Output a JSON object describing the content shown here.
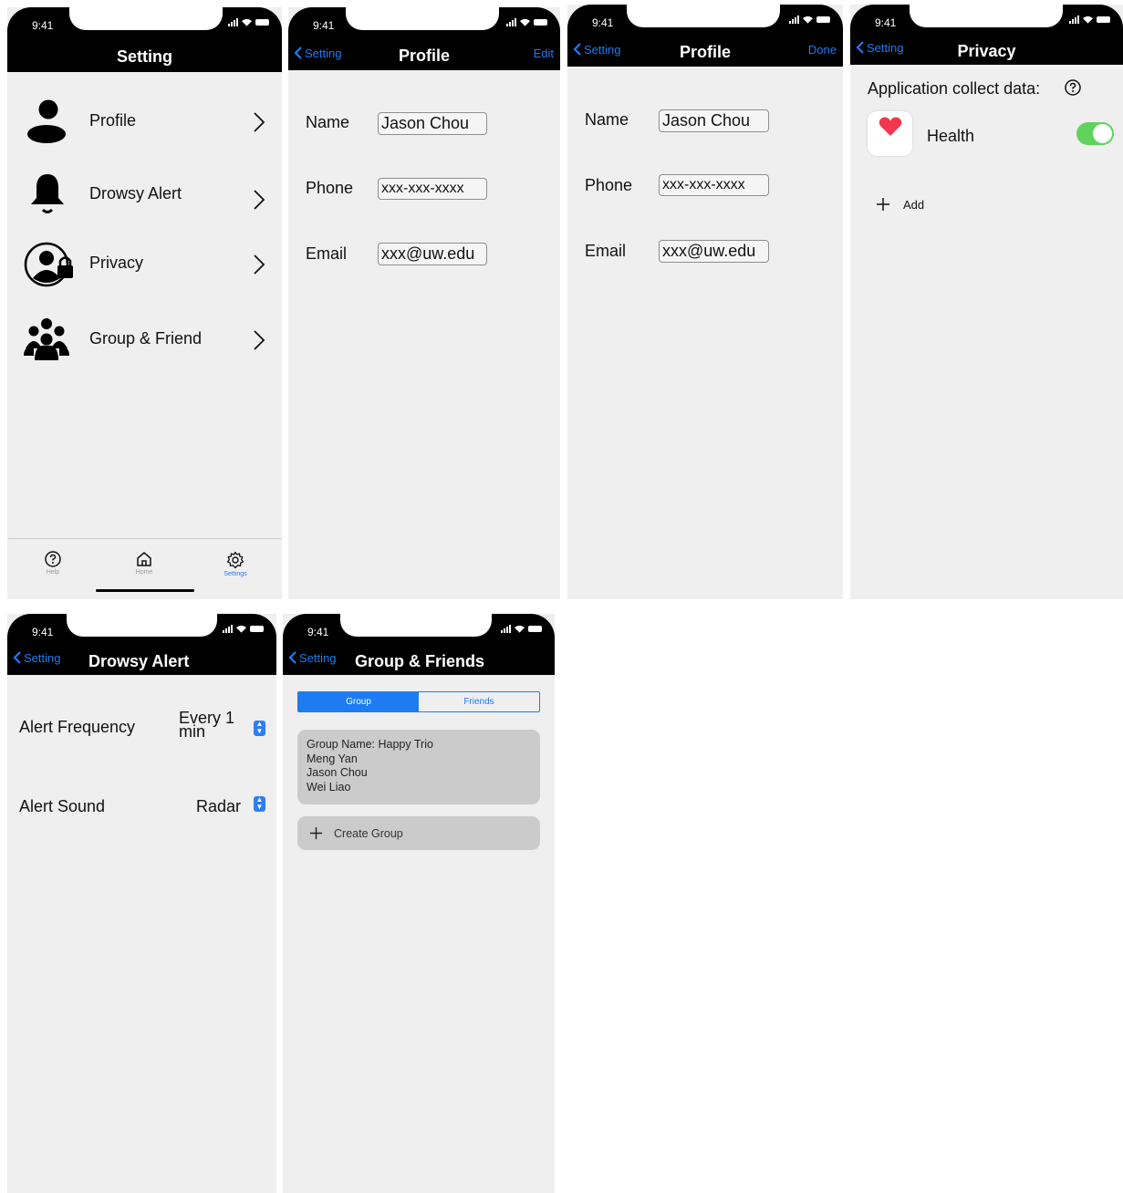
{
  "status_time": "9:41",
  "settings_screen": {
    "title": "Setting",
    "items": [
      {
        "label": "Profile",
        "icon": "person-icon"
      },
      {
        "label": "Drowsy Alert",
        "icon": "bell-icon"
      },
      {
        "label": "Privacy",
        "icon": "user-lock-icon"
      },
      {
        "label": "Group & Friend",
        "icon": "users-group-icon"
      }
    ],
    "tabbar": [
      {
        "label": "Help",
        "icon": "help-icon"
      },
      {
        "label": "Home",
        "icon": "home-icon"
      },
      {
        "label": "Settings",
        "icon": "gear-icon"
      }
    ]
  },
  "profile_screen": {
    "back_label": "Setting",
    "title": "Profile",
    "action_label": "Edit",
    "fields": [
      {
        "label": "Name",
        "value": "Jason Chou"
      },
      {
        "label": "Phone",
        "value": "xxx-xxx-xxxx"
      },
      {
        "label": "Email",
        "value": "xxx@uw.edu"
      }
    ]
  },
  "profile_edit_screen": {
    "back_label": "Setting",
    "title": "Profile",
    "action_label": "Done",
    "fields": [
      {
        "label": "Name",
        "value": "Jason Chou"
      },
      {
        "label": "Phone",
        "value": "xxx-xxx-xxxx"
      },
      {
        "label": "Email",
        "value": "xxx@uw.edu"
      }
    ]
  },
  "privacy_screen": {
    "back_label": "Setting",
    "title": "Privacy",
    "heading": "Application collect data:",
    "app_label": "Health",
    "toggle_on": true,
    "add_label": "Add"
  },
  "drowsy_screen": {
    "back_label": "Setting",
    "title": "Drowsy Alert",
    "frequency_label": "Alert Frequency",
    "frequency_value_line1": "Every 1",
    "frequency_value_line2": "min",
    "sound_label": "Alert Sound",
    "sound_value": "Radar"
  },
  "group_screen": {
    "back_label": "Setting",
    "title": "Group & Friends",
    "segments": [
      "Group",
      "Friends"
    ],
    "group_card": {
      "name_line": "Group Name: Happy Trio",
      "members": [
        "Meng Yan",
        "Jason Chou",
        "Wei Liao"
      ]
    },
    "create_label": "Create Group"
  },
  "colors": {
    "accent": "#1e7bf2",
    "toggle": "#5fd35c",
    "header": "#000000",
    "background": "#efefef"
  }
}
